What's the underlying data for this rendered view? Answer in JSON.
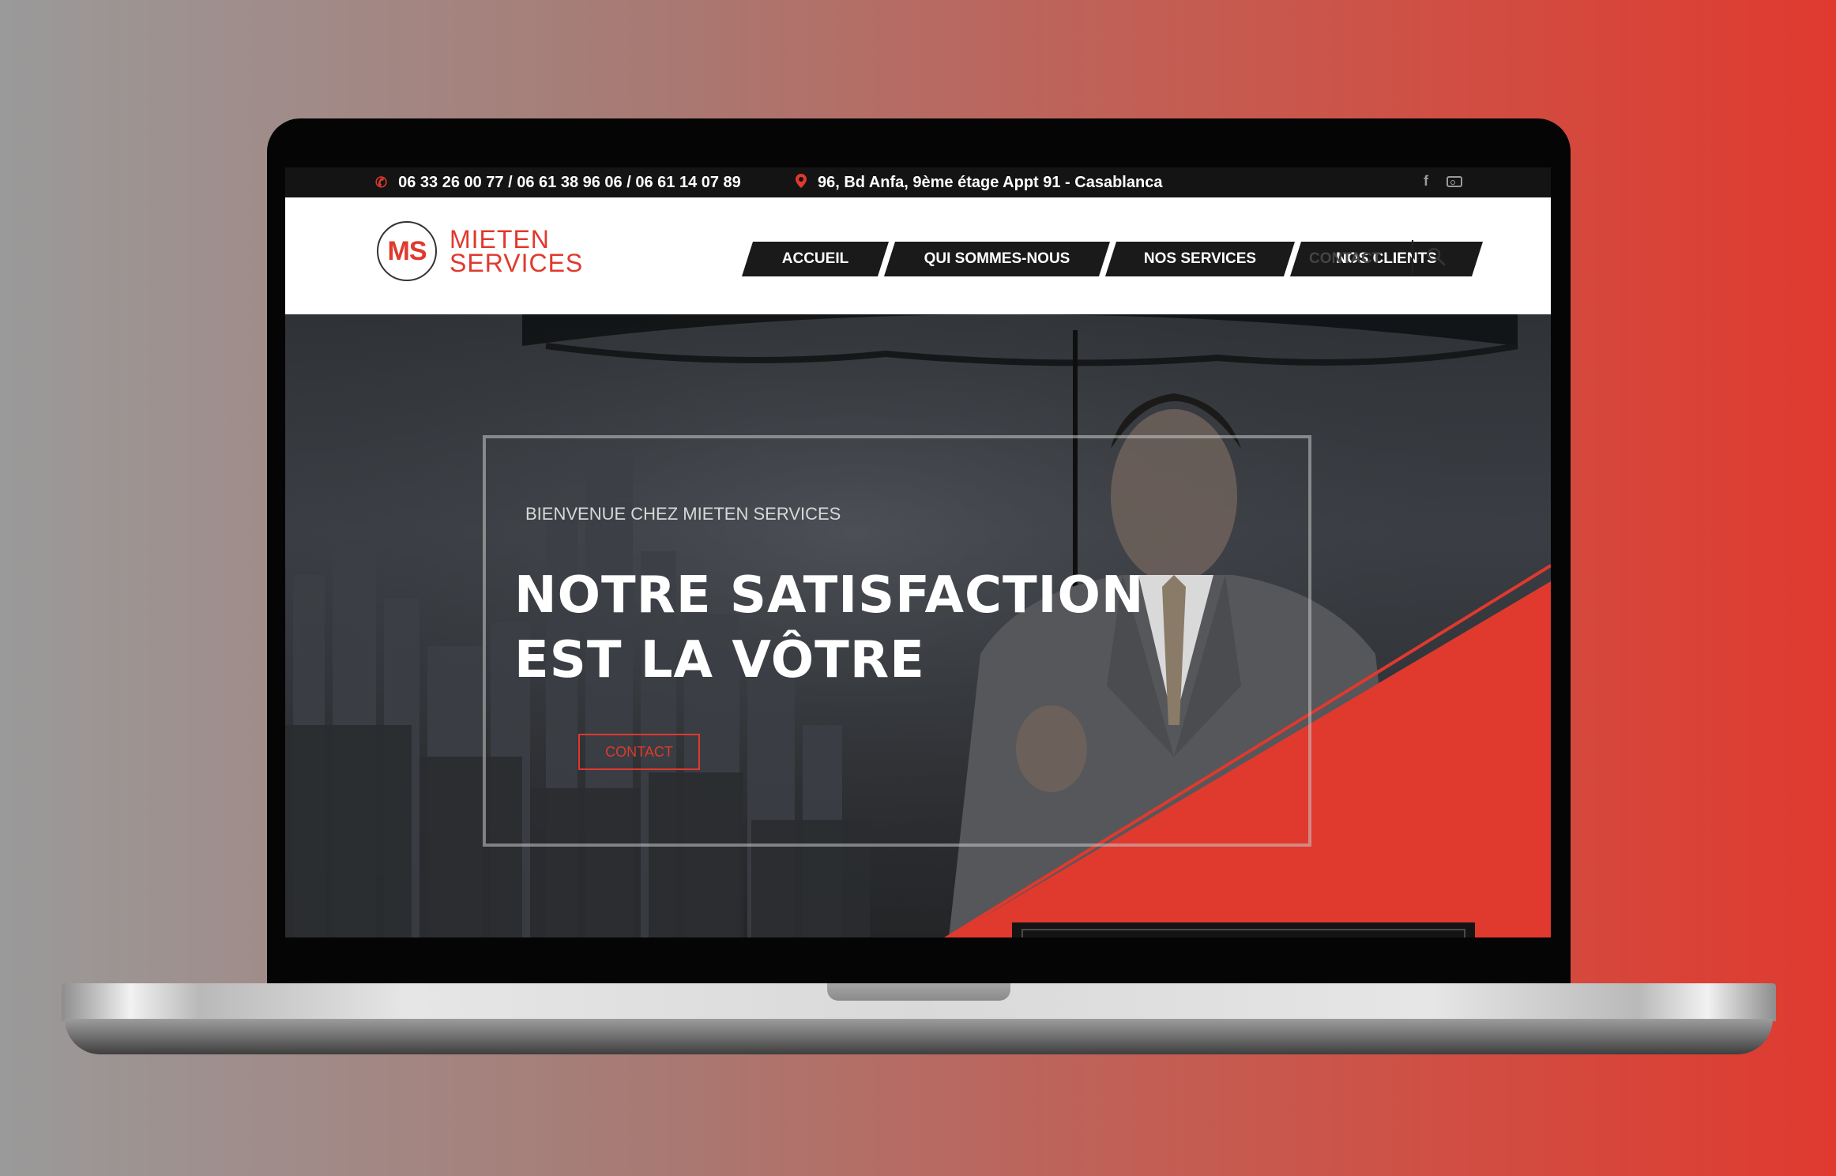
{
  "topbar": {
    "phone_icon": "phone-icon",
    "phones": "06 33 26 00 77 / 06 61 38 96 06 / 06 61 14 07 89",
    "address_icon": "map-marker-icon",
    "address": "96, Bd Anfa, 9ème étage Appt 91 - Casablanca",
    "social": [
      "facebook-icon",
      "instagram-icon"
    ],
    "facebook_glyph": "f"
  },
  "logo": {
    "monogram": "MS",
    "line1": "MIETEN",
    "line2": "SERVICES"
  },
  "nav": {
    "items": [
      "ACCUEIL",
      "QUI SOMMES-NOUS",
      "NOS SERVICES",
      "NOS CLIENTS"
    ],
    "contact": "CONTACT",
    "search_icon": "search-icon"
  },
  "hero": {
    "eyebrow": "BIENVENUE CHEZ MIETEN SERVICES",
    "title_line1": "NOTRE SATISFACTION",
    "title_line2": "EST LA VÔTRE",
    "button": "CONTACT"
  },
  "colors": {
    "accent": "#e0392e",
    "dark": "#1a1a1a",
    "background_left": "#9a9a9a",
    "background_right": "#e03a2f"
  }
}
